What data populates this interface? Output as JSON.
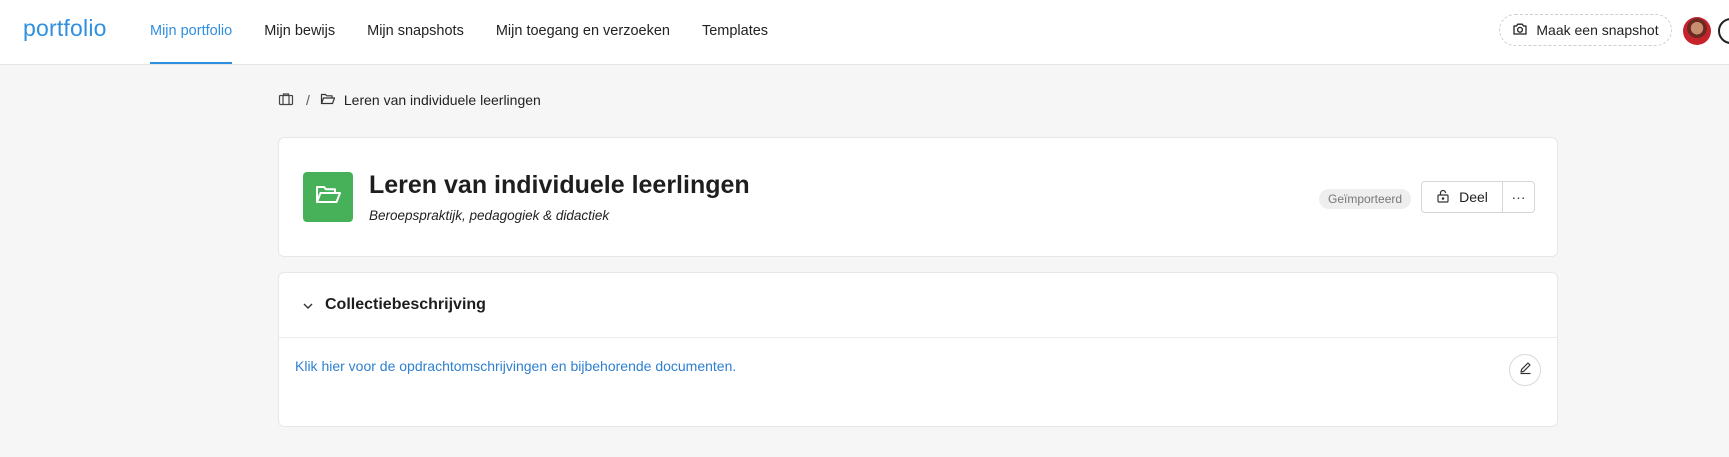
{
  "app": {
    "logo": "portfolio",
    "accent_color": "#2f8fe0"
  },
  "nav": {
    "items": [
      {
        "label": "Mijn portfolio",
        "active": true
      },
      {
        "label": "Mijn bewijs",
        "active": false
      },
      {
        "label": "Mijn snapshots",
        "active": false
      },
      {
        "label": "Mijn toegang en verzoeken",
        "active": false
      },
      {
        "label": "Templates",
        "active": false
      }
    ],
    "snapshot_label": "Maak een snapshot",
    "snapshot_icon": "camera-icon",
    "avatar_icon": "user-avatar",
    "account_icon": "account-circle-icon"
  },
  "breadcrumb": {
    "home_icon": "briefcase-icon",
    "separator": "/",
    "folder_icon": "folder-open-icon",
    "current": "Leren van individuele leerlingen"
  },
  "collection": {
    "title": "Leren van individuele leerlingen",
    "subtitle": "Beroepspraktijk, pedagogiek & didactiek",
    "badge": "Geïmporteerd",
    "share_label": "Deel",
    "more_label": "···",
    "tile_color": "#47b15a"
  },
  "description": {
    "heading": "Collectiebeschrijving",
    "link_text": "Klik hier voor de opdrachtomschrijvingen en bijbehorende documenten.",
    "link_color": "#2f80d1"
  }
}
